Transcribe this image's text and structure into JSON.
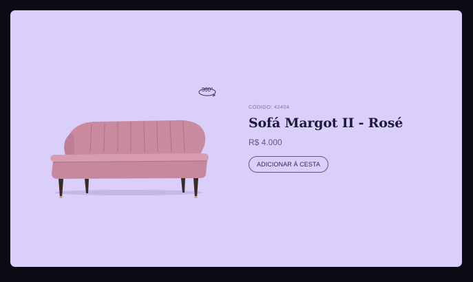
{
  "product": {
    "code": "CÓDIGO: 42404",
    "name": "Sofá Margot II - Rosé",
    "price": "R$ 4.000",
    "add_to_cart_label": "ADICIONAR À CESTA",
    "image_icon": "sofa-image",
    "view_360_icon": "rotate-360-icon",
    "view_360_text": "360°"
  },
  "colors": {
    "page_background": "#0c0a14",
    "card_background": "#d9cffa",
    "sofa_fabric": "#cf8fa3",
    "title_text": "#1e1a3a"
  }
}
